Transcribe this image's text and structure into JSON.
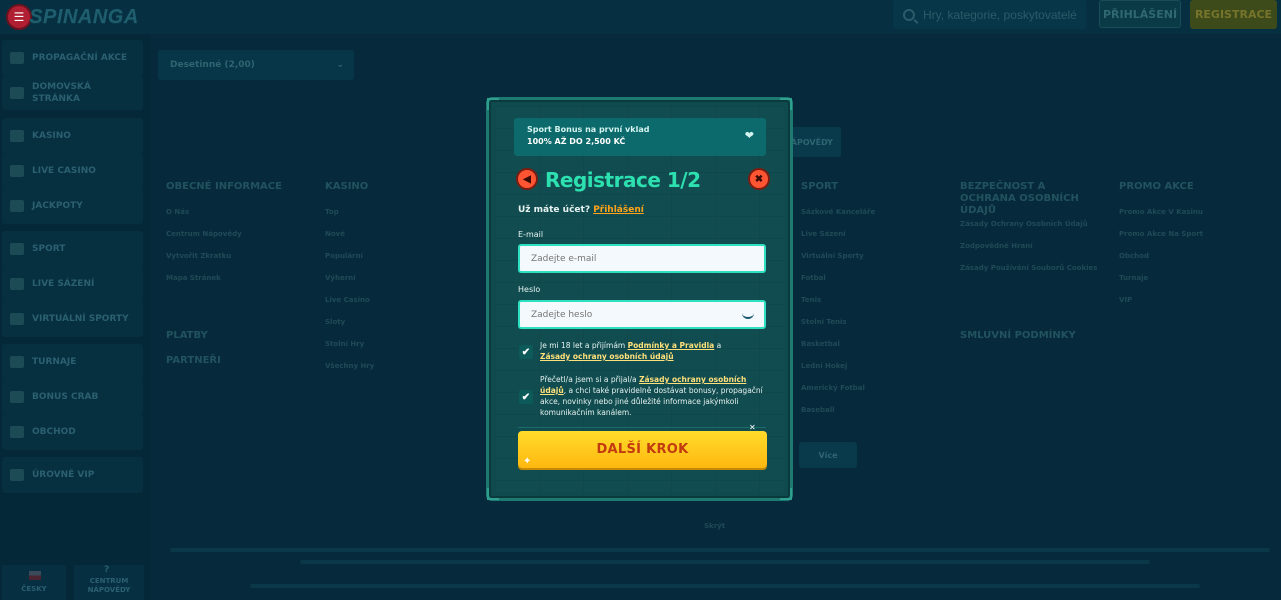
{
  "header": {
    "logo_text": "SPINANGA",
    "search_placeholder": "Hry, kategorie, poskytovatelé",
    "login_label": "PŘIHLÁŠENÍ",
    "register_label": "REGISTRACE"
  },
  "sidebar": {
    "items": [
      {
        "label": "PROPAGAČNÍ AKCE",
        "icon": "gift-icon"
      },
      {
        "label": "DOMOVSKÁ STRÁNKA",
        "icon": "home-icon"
      },
      {
        "label": "KASINO",
        "icon": "casino-icon"
      },
      {
        "label": "LIVE CASINO",
        "icon": "dealer-icon"
      },
      {
        "label": "JACKPOTY",
        "icon": "jackpot-icon"
      },
      {
        "label": "SPORT",
        "icon": "ball-icon"
      },
      {
        "label": "LIVE SÁZENÍ",
        "icon": "live-icon"
      },
      {
        "label": "VIRTUÁLNÍ SPORTY",
        "icon": "virtual-icon"
      },
      {
        "label": "TURNAJE",
        "icon": "trophy-icon"
      },
      {
        "label": "BONUS CRAB",
        "icon": "crab-icon"
      },
      {
        "label": "OBCHOD",
        "icon": "shop-icon"
      },
      {
        "label": "ÚROVNĚ VIP",
        "icon": "diamond-icon"
      }
    ],
    "language": "ČESKY",
    "help_center": "CENTRUM NÁPOVĚDY",
    "help_icon": "?"
  },
  "background": {
    "odds_select_value": "Desetinné (2,00)",
    "tab_partial": "NÁPOVĚDY",
    "columns": {
      "general": {
        "title": "OBECNÉ INFORMACE",
        "links": [
          "O Nás",
          "Centrum Nápovědy",
          "Vytvořit Zkratku",
          "Mapa Stránek"
        ]
      },
      "casino": {
        "title": "KASINO",
        "links": [
          "Top",
          "Nové",
          "Populární",
          "Výherní",
          "Live Casino",
          "Sloty",
          "Stolní Hry",
          "Všechny Hry"
        ]
      },
      "sport": {
        "title": "SPORT",
        "links": [
          "Sázkové Kanceláře",
          "Live Sázení",
          "Virtuální Sporty",
          "Fotbal",
          "Tenis",
          "Stolní Tenis",
          "Basketbal",
          "Lední Hokej",
          "Americký Fotbal",
          "Baseball"
        ]
      },
      "security": {
        "title": "BEZPEČNOST A OCHRANA OSOBNÍCH ÚDAJŮ",
        "links": [
          "Zásady Ochrany Osobních Údajů",
          "Zodpovědné Hraní",
          "Zásady Používání Souborů Cookies"
        ]
      },
      "promo": {
        "title": "PROMO AKCE",
        "links": [
          "Promo Akce V Kasinu",
          "Promo Akce Na Sport",
          "Obchod",
          "Turnaje",
          "VIP"
        ]
      },
      "payments": "PLATBY",
      "partners": "PARTNEŘI",
      "contracts": "SMLUVNÍ PODMÍNKY"
    },
    "more_label": "Více",
    "hide_label": "Skrýt"
  },
  "modal": {
    "bonus_title": "Sport Bonus na první vklad",
    "bonus_value": "100% AŽ DO 2,500 KČ",
    "title": "Registrace 1/2",
    "have_account": "Už máte účet?",
    "login_link": "Přihlášení",
    "email_label": "E-mail",
    "email_placeholder": "Zadejte e-mail",
    "password_label": "Heslo",
    "password_placeholder": "Zadejte heslo",
    "consent1_pre": "Je mi 18 let a přijímám",
    "consent1_link1": "Podmínky a Pravidla",
    "consent1_mid": "a",
    "consent1_link2": "Zásady ochrany osobních údajů",
    "consent2_pre": "Přečetl/a jsem si a přijal/a",
    "consent2_link": "Zásady ochrany osobních údajů",
    "consent2_post": ", a chci také pravidelně dostávat bonusy, propagační akce, novinky nebo jiné důležité informace jakýmkoli komunikačním kanálem.",
    "next_label": "DALŠÍ KROK"
  },
  "colors": {
    "accent_teal": "#2de0b0",
    "button_yellow": "#ffc91a",
    "link_orange": "#ffa31a"
  }
}
